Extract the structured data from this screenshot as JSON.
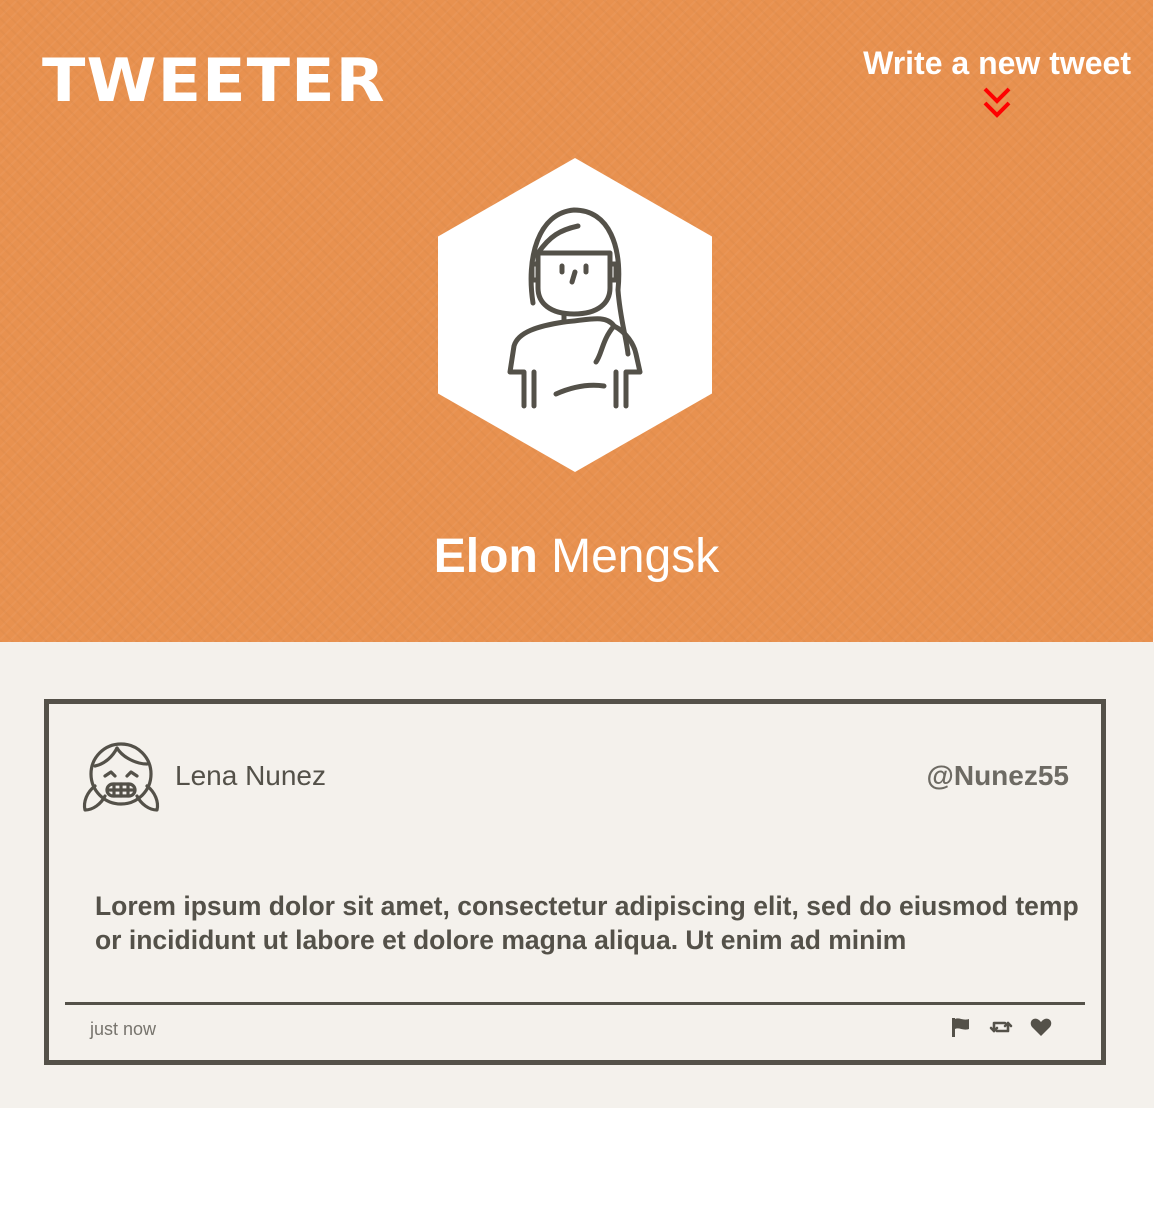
{
  "header": {
    "logo": "TWEETER",
    "compose_label": "Write a new tweet",
    "compose_icon": "double-chevron-down-icon",
    "background_color": "#e8914f",
    "accent_color": "#ff0000"
  },
  "profile": {
    "first_name": "Elon",
    "last_name": "Mengsk",
    "avatar_icon": "long-hair-person-avatar-icon"
  },
  "tweets": [
    {
      "author_name": "Lena Nunez",
      "handle": "@Nunez55",
      "avatar_icon": "smiling-girl-avatar-icon",
      "text": "Lorem ipsum dolor sit amet, consectetur adipiscing elit, sed do eiusmod tempor incididunt ut labore et dolore magna aliqua. Ut enim ad minim",
      "timestamp": "just now",
      "actions": [
        "flag-icon",
        "retweet-icon",
        "heart-icon"
      ]
    }
  ],
  "colors": {
    "feed_background": "#f4f1ec",
    "ink": "#545149"
  }
}
